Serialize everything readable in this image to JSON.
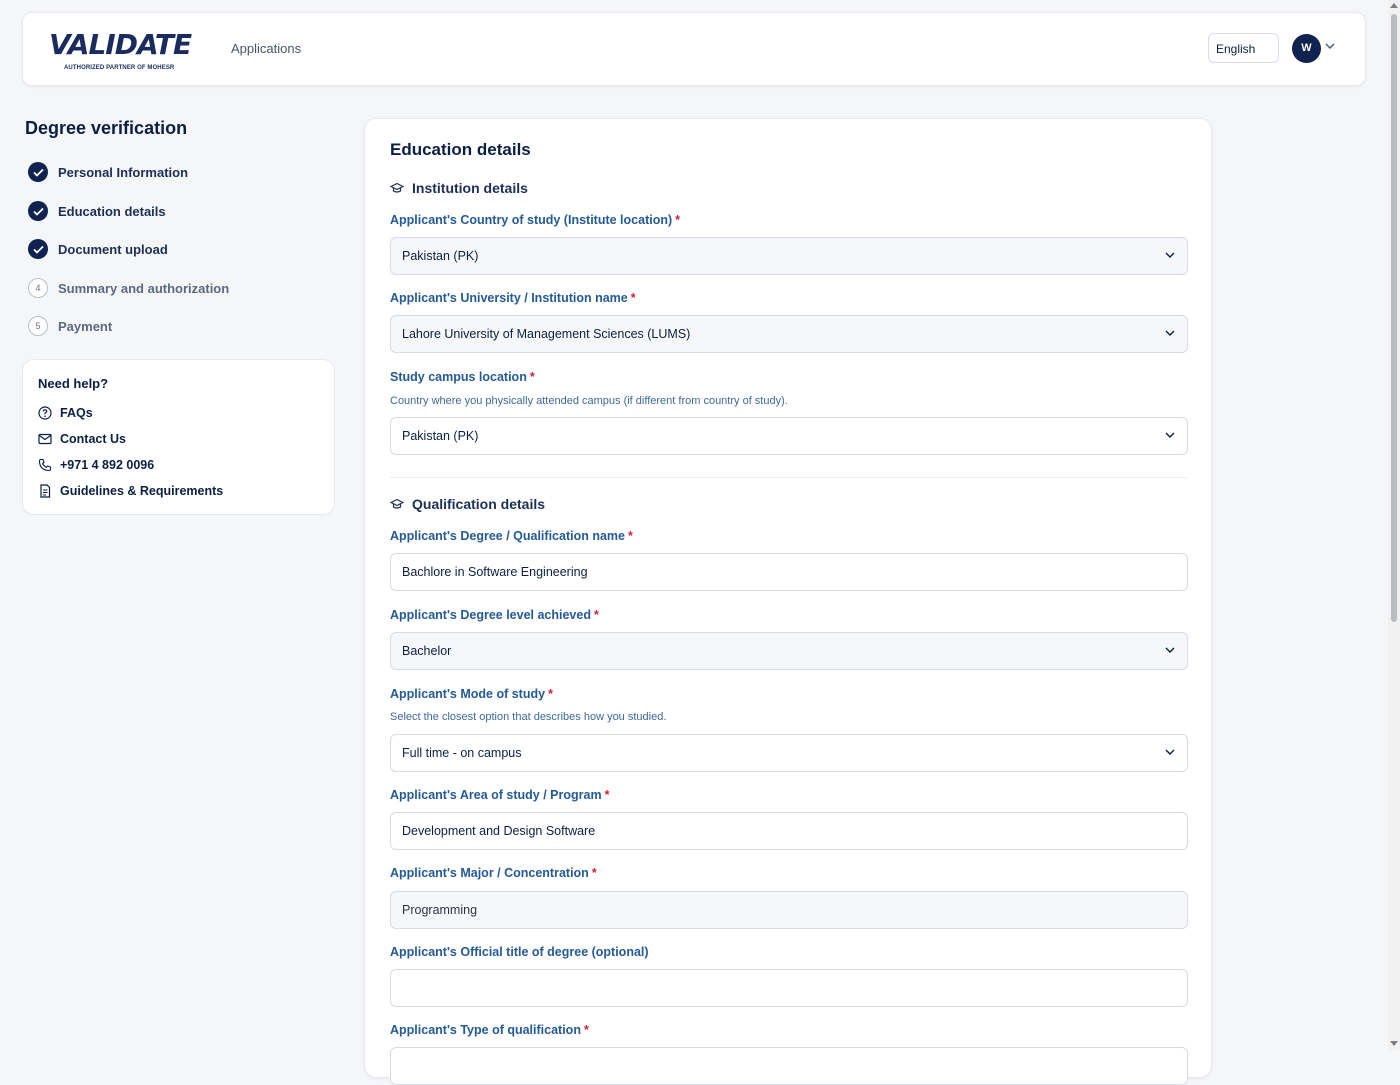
{
  "header": {
    "logo_text": "VALIDATE",
    "logo_tagline": "AUTHORIZED PARTNER OF MOHESR",
    "nav_applications": "Applications",
    "language": "English",
    "avatar_initial": "W"
  },
  "sidebar": {
    "title": "Degree verification",
    "steps": [
      {
        "label": "Personal Information",
        "status": "done"
      },
      {
        "label": "Education details",
        "status": "done"
      },
      {
        "label": "Document upload",
        "status": "done"
      },
      {
        "label": "Summary and authorization",
        "status": "todo",
        "number": "4"
      },
      {
        "label": "Payment",
        "status": "todo",
        "number": "5"
      }
    ]
  },
  "help": {
    "title": "Need help?",
    "items": [
      {
        "label": "FAQs",
        "icon": "question-circle-icon"
      },
      {
        "label": "Contact Us",
        "icon": "mail-icon"
      },
      {
        "label": "+971 4 892 0096",
        "icon": "phone-icon"
      },
      {
        "label": "Guidelines & Requirements",
        "icon": "document-icon"
      }
    ]
  },
  "form": {
    "title": "Education details",
    "institution_section": "Institution details",
    "qualification_section": "Qualification details",
    "required_mark": "*",
    "fields": {
      "country_of_study": {
        "label": "Applicant's Country of study (Institute location)",
        "value": "Pakistan (PK)"
      },
      "institution_name": {
        "label": "Applicant's University / Institution name",
        "value": "Lahore University of Management Sciences (LUMS)"
      },
      "campus_location": {
        "label": "Study campus location",
        "hint": "Country where you physically attended campus (if different from country of study).",
        "value": "Pakistan (PK)"
      },
      "degree_name": {
        "label": "Applicant's Degree / Qualification name",
        "value": "Bachlore in Software Engineering"
      },
      "degree_level": {
        "label": "Applicant's Degree level achieved",
        "value": "Bachelor"
      },
      "mode_of_study": {
        "label": "Applicant's Mode of study",
        "hint": "Select the closest option that describes how you studied.",
        "value": "Full time - on campus"
      },
      "area_of_study": {
        "label": "Applicant's Area of study / Program",
        "value": "Development and Design Software"
      },
      "major": {
        "label": "Applicant's Major / Concentration",
        "value": "Programming"
      },
      "official_title": {
        "label": "Applicant's Official title of degree (optional)",
        "value": ""
      },
      "qualification_type": {
        "label": "Applicant's Type of qualification"
      }
    }
  },
  "colors": {
    "navy": "#0f2250",
    "label_blue": "#245a96",
    "required_red": "#d21f3c"
  }
}
